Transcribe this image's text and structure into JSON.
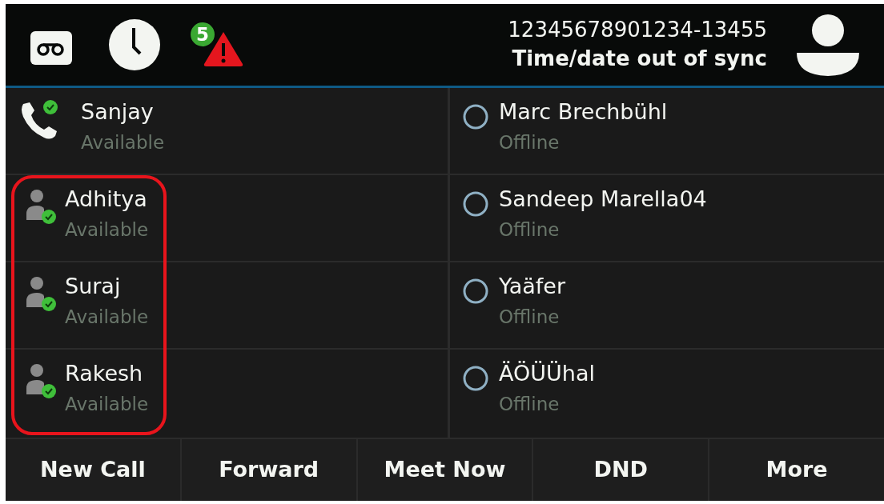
{
  "header": {
    "alert_count": "5",
    "line_number": "12345678901234-13455",
    "status_message": "Time/date out of sync"
  },
  "contacts_left": [
    {
      "kind": "call",
      "name": "Sanjay",
      "status": "Available",
      "highlighted": false
    },
    {
      "kind": "person",
      "name": "Adhitya",
      "status": "Available",
      "highlighted": true
    },
    {
      "kind": "person",
      "name": "Suraj",
      "status": "Available",
      "highlighted": true
    },
    {
      "kind": "person",
      "name": "Rakesh",
      "status": "Available",
      "highlighted": true
    }
  ],
  "contacts_right": [
    {
      "kind": "offline",
      "name": "Marc Brechbühl",
      "status": "Offline"
    },
    {
      "kind": "offline",
      "name": "Sandeep Marella04",
      "status": "Offline"
    },
    {
      "kind": "offline",
      "name": "Yaäfer",
      "status": "Offline"
    },
    {
      "kind": "offline",
      "name": "ÄÖÜÜhal",
      "status": "Offline"
    }
  ],
  "softkeys": [
    "New Call",
    "Forward",
    "Meet Now",
    "DND",
    "More"
  ]
}
